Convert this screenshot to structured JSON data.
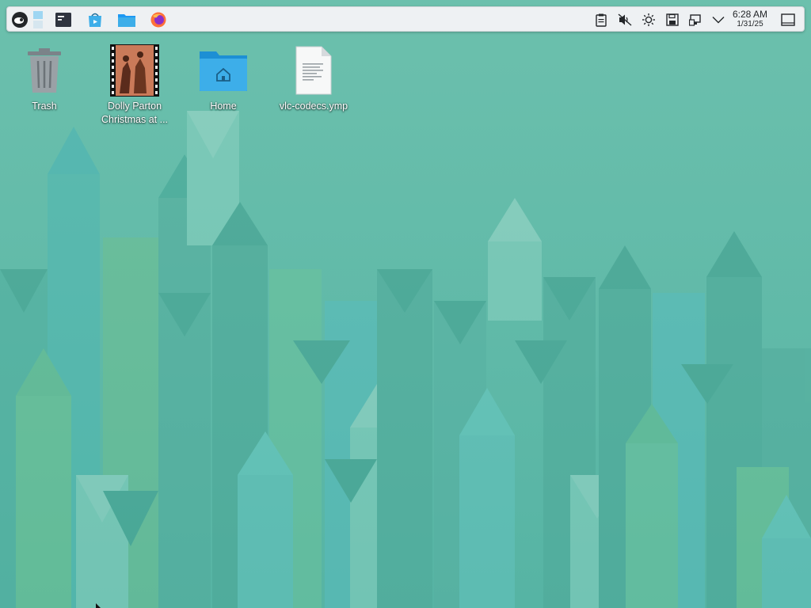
{
  "desktop": {
    "icons": [
      {
        "label": "Trash",
        "icon": "trash-icon"
      },
      {
        "label": "Dolly Parton Christmas at ...",
        "icon": "video-thumbnail-icon"
      },
      {
        "label": "Home",
        "icon": "home-folder-icon"
      },
      {
        "label": "vlc-codecs.ymp",
        "icon": "document-icon"
      }
    ]
  },
  "panel": {
    "launchers": [
      "opensuse-menu-icon",
      "pager-icon",
      "terminal-icon",
      "software-center-icon",
      "file-manager-icon",
      "firefox-icon"
    ],
    "tray": [
      "clipboard-icon",
      "volume-muted-icon",
      "brightness-icon",
      "save-disk-icon",
      "network-icon",
      "chevron-down-icon",
      "show-desktop-icon"
    ],
    "clock": {
      "time": "6:28 AM",
      "date": "1/31/25"
    }
  },
  "colors": {
    "wallpaper": "#5fbaa8",
    "panel": "#eef1f3",
    "accent": "#3daee9"
  }
}
